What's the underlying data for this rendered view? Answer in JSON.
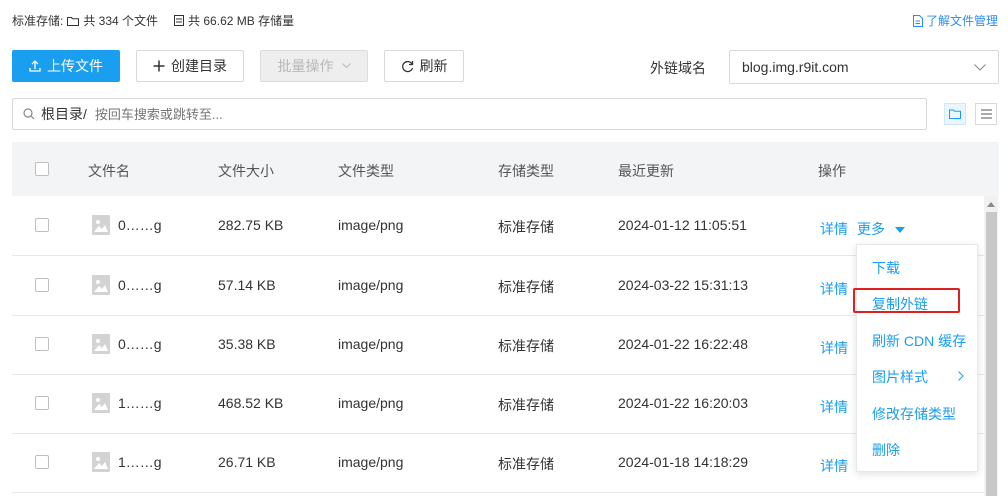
{
  "summary": {
    "storage_label": "标准存储:",
    "files_text": "共 334 个文件",
    "size_text": "共 66.62 MB 存储量",
    "help_link": "了解文件管理"
  },
  "toolbar": {
    "upload_label": "上传文件",
    "mkdir_label": "创建目录",
    "batch_label": "批量操作",
    "refresh_label": "刷新",
    "domain_label": "外链域名",
    "domain_value": "blog.img.r9it.com"
  },
  "search": {
    "path": "根目录/",
    "placeholder": "按回车搜索或跳转至..."
  },
  "table": {
    "headers": [
      "文件名",
      "文件大小",
      "文件类型",
      "存储类型",
      "最近更新",
      "操作"
    ],
    "rows": [
      {
        "name": "0……g",
        "size": "282.75 KB",
        "type": "image/png",
        "storage": "标准存储",
        "updated": "2024-01-12 11:05:51",
        "detail": "详情",
        "more": "更多"
      },
      {
        "name": "0……g",
        "size": "57.14 KB",
        "type": "image/png",
        "storage": "标准存储",
        "updated": "2024-03-22 15:31:13",
        "detail": "详情"
      },
      {
        "name": "0……g",
        "size": "35.38 KB",
        "type": "image/png",
        "storage": "标准存储",
        "updated": "2024-01-22 16:22:48",
        "detail": "详情"
      },
      {
        "name": "1……g",
        "size": "468.52 KB",
        "type": "image/png",
        "storage": "标准存储",
        "updated": "2024-01-22 16:20:03",
        "detail": "详情"
      },
      {
        "name": "1……g",
        "size": "26.71 KB",
        "type": "image/png",
        "storage": "标准存储",
        "updated": "2024-01-18 14:18:29",
        "detail": "详情"
      }
    ]
  },
  "more_menu": {
    "items": [
      "下载",
      "复制外链",
      "刷新 CDN 缓存",
      "图片样式",
      "修改存储类型",
      "删除"
    ],
    "highlighted": "复制外链"
  },
  "colors": {
    "primary": "#1a9ef0",
    "highlight": "#e02020"
  }
}
